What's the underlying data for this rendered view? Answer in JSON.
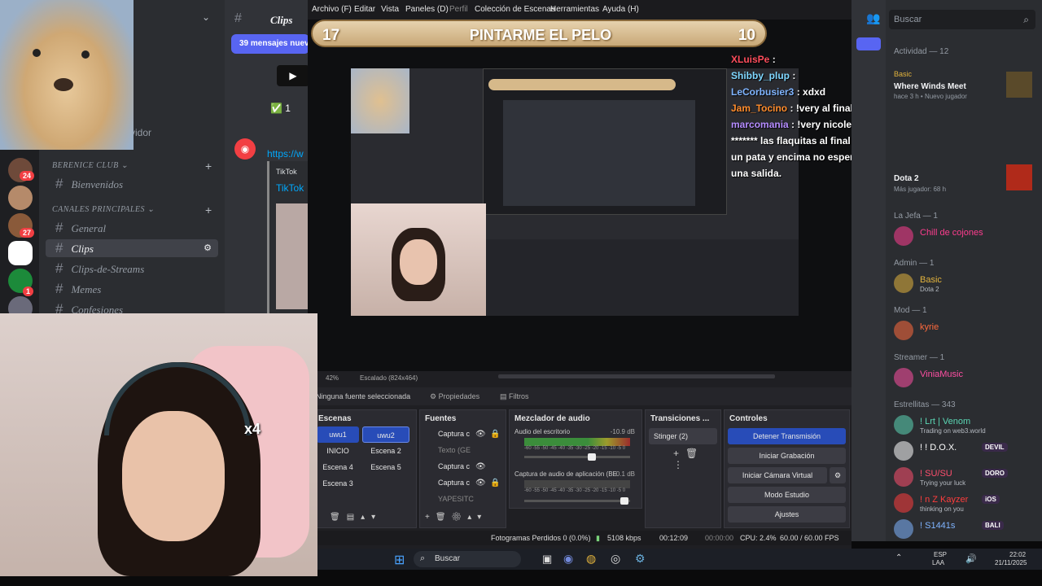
{
  "obs_menu": [
    "Archivo (F)",
    "Editar",
    "Vista",
    "Paneles (D)",
    "Perfil",
    "Colección de Escenas",
    "Herramientas",
    "Ayuda (H)"
  ],
  "game_title": {
    "left_score": "17",
    "title": "PINTARME EL PELO",
    "right_score": "10"
  },
  "chat_lines": [
    {
      "user": "XLuisPe",
      "text": ":",
      "color": "#ff4d5c"
    },
    {
      "user": "Shibby_plup",
      "text": ":",
      "color": "#7fd7ff"
    },
    {
      "user": "LeCorbusier3",
      "text": ": xdxd",
      "color": "#7fb4ff"
    },
    {
      "user": "Jam_Tocino",
      "text": ": !very al final ke tonalidad kedo no veo bien soy ciego",
      "color": "#ff8c2c"
    },
    {
      "user": "marcomania",
      "text": ": !very nicole en serio te lo digo tienes que armar una",
      "color": "#b58cff"
    },
    {
      "user": "",
      "text": "******* las flaquitas al final son las que mas donan por verte coquetear con",
      "color": "#ffffff"
    },
    {
      "user": "",
      "text": "un pata y encima no esperan que por eso te enamores de ellas o les debas",
      "color": "#ffffff"
    },
    {
      "user": "",
      "text": "una salida.",
      "color": "#ffffff"
    }
  ],
  "preview_bar": {
    "zoom": "42%",
    "scale": "Escalado (824x464)"
  },
  "source_toolbar": {
    "no_source": "Ninguna fuente seleccionada",
    "properties": "Propiedades",
    "filters": "Filtros"
  },
  "docks": {
    "scenes": {
      "title": "Escenas",
      "items": [
        "uwu1",
        "uwu2",
        "INICIO",
        "Escena 2",
        "Escena 4",
        "Escena 5",
        "Escena 3"
      ]
    },
    "sources": {
      "title": "Fuentes",
      "items": [
        "Captura c",
        "Texto (GE",
        "Captura c",
        "Captura c",
        "YAPESITC"
      ]
    },
    "mixer": {
      "title": "Mezclador de audio",
      "desktop_label": "Audio del escritorio",
      "desktop_db": "-10.9 dB",
      "app_label": "Captura de audio de aplicación (BE",
      "app_db": "-0.1 dB",
      "scale": "-60 -55 -50 -45 -40 -35 -30 -25 -20 -15 -10 -5 0"
    },
    "transitions": {
      "title": "Transiciones ...",
      "selected": "Stinger (2)"
    },
    "controls": {
      "title": "Controles",
      "buttons": [
        "Detener Transmisión",
        "Iniciar Grabación",
        "Iniciar Cámara Virtual",
        "Modo Estudio",
        "Ajustes"
      ]
    }
  },
  "status": {
    "dropped": "Fotogramas Perdidos 0 (0.0%)",
    "bitrate": "5108 kbps",
    "live_time": "00:12:09",
    "rec_time": "00:00:00",
    "cpu": "CPU: 2.4%",
    "fps": "60.00 / 60.00 FPS"
  },
  "discord": {
    "server_name": "BERENICE CLUB",
    "cat_main": "CANALES PRINCIPALES",
    "channels": [
      "Bienvenidos",
      "General",
      "Clips",
      "Clips-de-Streams",
      "Memes",
      "Confesiones"
    ],
    "header_channel": "Clips",
    "new_messages": "39 mensajes nuevo",
    "msg_reaction": "1",
    "link": "https://w",
    "embed_title": "TikTok",
    "embed_link": "TikTok",
    "behind_text": "vidor",
    "badges": [
      "24",
      "27",
      "1"
    ],
    "search_placeholder": "Buscar",
    "members": {
      "activity": "Actividad — 12",
      "act1_title": "Where Winds Meet",
      "act1_sub": "hace 3 h • Nuevo jugador",
      "act2_title": "Dota 2",
      "act2_sub": "Más jugador: 68 h",
      "sections": [
        {
          "label": "La Jefa",
          "count": "— 1",
          "members": [
            {
              "name": "Chill de cojones",
              "sub": "",
              "color": "#ff3d8f"
            }
          ]
        },
        {
          "label": "Admin — 1",
          "count": "",
          "members": [
            {
              "name": "Basic",
              "sub": "Dota 2",
              "color": "#e2b33d"
            }
          ]
        },
        {
          "label": "Mod — 1",
          "count": "",
          "members": [
            {
              "name": "kyrie",
              "sub": "",
              "color": "#ff6a3d"
            }
          ]
        },
        {
          "label": "Streamer — 1",
          "count": "",
          "members": [
            {
              "name": "ViniaMusic",
              "sub": "",
              "color": "#ff4fa3"
            }
          ]
        },
        {
          "label": "Estrellitas — 343",
          "count": "",
          "members": [
            {
              "name": "! Lrt | Venom",
              "sub": "Trading on web3.world",
              "color": "#5bd6b4"
            },
            {
              "name": "! ! D.O.X.",
              "sub": "",
              "color": "#ffffff",
              "tag": "DEVIL"
            },
            {
              "name": "! SU/SU",
              "sub": "Trying your luck",
              "color": "#ff4f6e",
              "tag": "DORO"
            },
            {
              "name": "! n Z Kayzer",
              "sub": "thinking on you",
              "color": "#ff3d3d",
              "tag": "iOS"
            },
            {
              "name": "! S1441s",
              "sub": "",
              "color": "#7fb4ff",
              "tag": "BALI"
            }
          ]
        }
      ]
    }
  },
  "taskbar": {
    "search": "Buscar",
    "lang": "ESP",
    "lang2": "LAA",
    "time": "22:02",
    "date": "21/11/2025"
  }
}
